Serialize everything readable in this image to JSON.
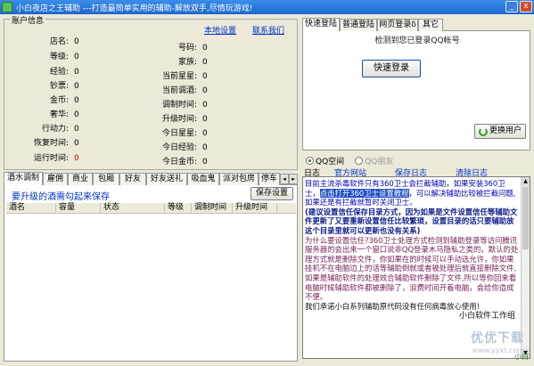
{
  "window": {
    "title": "小白夜店之王辅助  ---打造最简单实用的辅助-解放双手,尽情玩游戏!",
    "min_label": "_",
    "close_label": "x"
  },
  "account": {
    "legend": "账户信息",
    "link_local": "本地设置",
    "link_contact": "联系我们",
    "left_stats": [
      {
        "label": "店名:",
        "value": "0"
      },
      {
        "label": "等级:",
        "value": "0"
      },
      {
        "label": "经验:",
        "value": "0"
      },
      {
        "label": "钞票:",
        "value": "0"
      },
      {
        "label": "金币:",
        "value": "0"
      },
      {
        "label": "奢华:",
        "value": "0"
      },
      {
        "label": "行动力:",
        "value": "0"
      },
      {
        "label": "恢复时间:",
        "value": "0"
      },
      {
        "label": "运行时间:",
        "value": "0"
      }
    ],
    "right_stats": [
      {
        "label": "号码:",
        "value": "0"
      },
      {
        "label": "家族:",
        "value": "0"
      },
      {
        "label": "当前星星:",
        "value": "0"
      },
      {
        "label": "当前调酒:",
        "value": "0"
      },
      {
        "label": "调制时间:",
        "value": "0"
      },
      {
        "label": "升级时间:",
        "value": "0"
      },
      {
        "label": "今日星星:",
        "value": "0"
      },
      {
        "label": "今日经验:",
        "value": "0"
      },
      {
        "label": "今日金币:",
        "value": "0"
      }
    ]
  },
  "left_tabs": [
    "酒水调制",
    "雇佣",
    "商业",
    "包厢",
    "好友",
    "好友送礼",
    "吸血鬼",
    "派对包房",
    "停车"
  ],
  "left_scroll": {
    "left": "◂",
    "right": "▸"
  },
  "wine": {
    "note": "要升级的酒需勾起来保存",
    "save_label": "保存设置",
    "columns": [
      "酒名",
      "容量",
      "状态",
      "等级",
      "调制时间",
      "升级时间"
    ]
  },
  "right_tabs": [
    "快速登陆",
    "普通登陆",
    "网页登录δ",
    "其它"
  ],
  "login": {
    "detect": "检测到您已登录QQ帐号",
    "quick_login": "快速登录",
    "change_user": "更换用户"
  },
  "radios": [
    {
      "label": "QQ空间",
      "selected": true,
      "disabled": false
    },
    {
      "label": "QQ朋友",
      "selected": false,
      "disabled": true
    }
  ],
  "log_bar": {
    "label": "日志",
    "official": "官方网站",
    "save_log": "保存日志",
    "clear_log": "清除日志"
  },
  "log": {
    "line1_pre": "目前主流杀毒软件只有360卫士会拦截辅助，如果安装360卫士，",
    "line1_hl": "点击打开360卫士设置教程",
    "line1_post": "，可以解决辅助比较被拦截问题,如果还是有拦截就暂时关闭卫士。",
    "line2": "(建议设置信任保存目录方式，因为如果是文件设置信任等辅助文件更新了又要重新设置信任比较繁琐，设置目录的话只要辅助放这个目录里就可以更新也没有关系)",
    "line3": "为什么要设置信任?360卫士处理方式检测到辅助登录等访问腾讯服务器的会出来一个窗口说非QQ登录木马隐私之类的，默认的处理方式就是删除文件，你如果在的时候可以手动选允许，你如果挂机不在电脑边上的话等辅助倒就或者被处理后就直接删除文件,如果是辅助软件的处理效合辅助软件删除了文件,所以等你回来看电脑时候辅助软件都被删除了，浪费时间开着电脑，会给你造成不便。",
    "line4": "我们承诺小白系列辅助原代码没有任何病毒放心使用!",
    "studio": "小白软件工作组"
  },
  "watermark": {
    "main": "优优下载",
    "sub": "www.yyxt.com"
  },
  "corner": "小白"
}
